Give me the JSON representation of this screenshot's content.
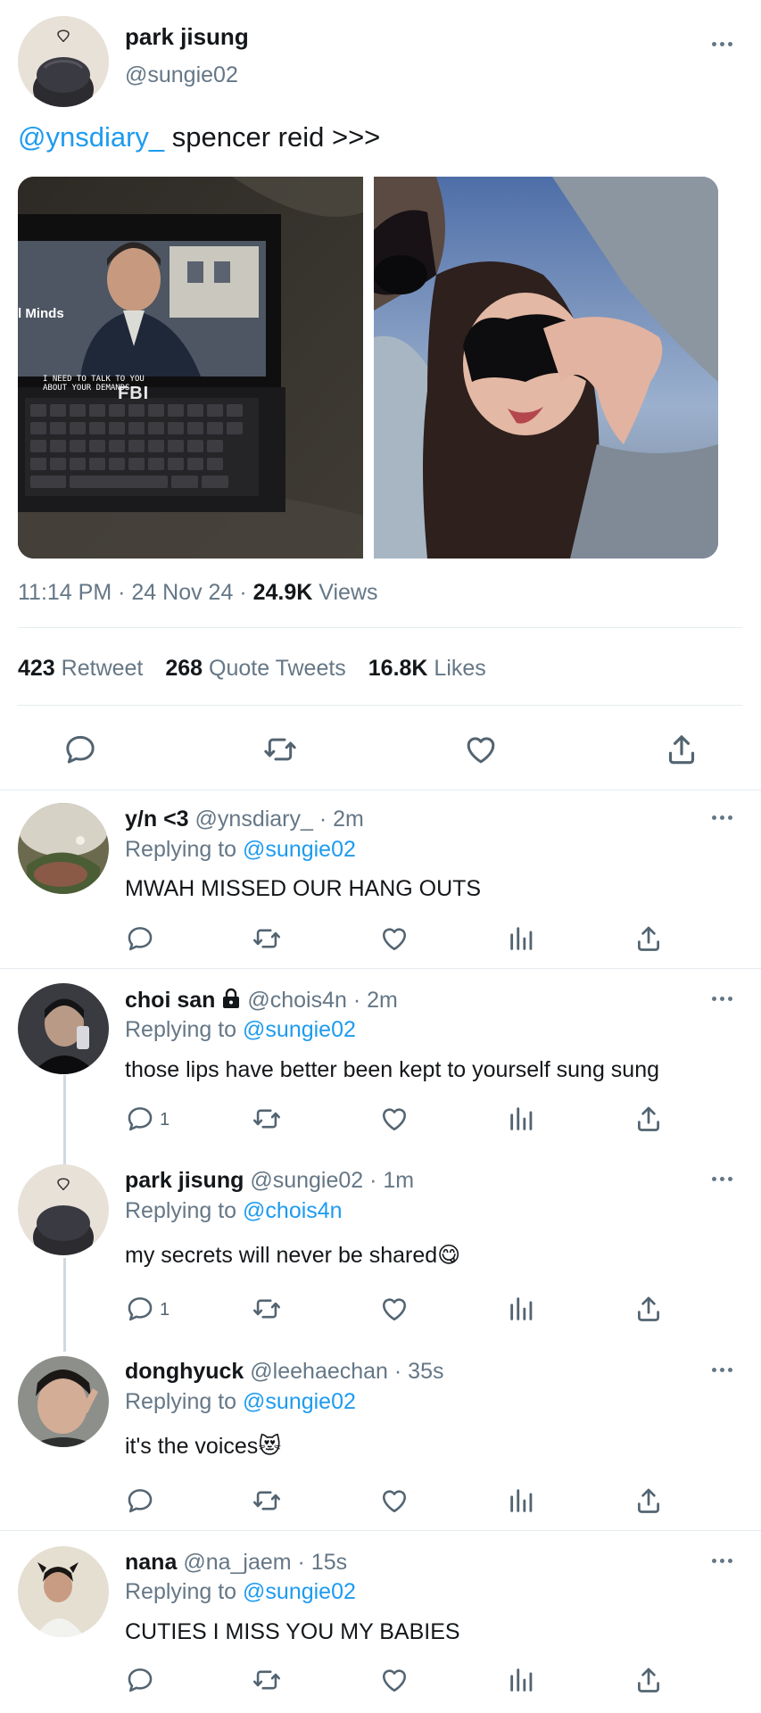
{
  "main_tweet": {
    "display_name": "park jisung",
    "handle": "@sungie02",
    "mention": "@ynsdiary_",
    "text": " spencer reid >>>",
    "image_1_overlay": {
      "show_title": "l Minds",
      "subtitle_line1": "I NEED TO TALK TO YOU",
      "subtitle_line2": "ABOUT YOUR DEMANDS",
      "badge": "FBI"
    },
    "time": "11:14 PM",
    "date": "24 Nov 24",
    "sep": "·",
    "views_count": "24.9K",
    "views_label": " Views",
    "stats": {
      "retweets": "423",
      "retweets_label": " Retweet",
      "quotes": "268",
      "quotes_label": " Quote Tweets",
      "likes": "16.8K",
      "likes_label": " Likes"
    }
  },
  "replies": [
    {
      "display_name": "y/n <3",
      "handle": "@ynsdiary_",
      "time": " · 2m",
      "replying_label": "Replying to ",
      "replying_to": "@sungie02",
      "text": "MWAH MISSED OUR HANG OUTS",
      "reply_count": ""
    },
    {
      "display_name": "choi san",
      "handle": "@chois4n",
      "time": " · 2m",
      "replying_label": "Replying to ",
      "replying_to": "@sungie02",
      "text": "those lips have better been kept to yourself sung sung",
      "reply_count": "1"
    },
    {
      "display_name": "park jisung",
      "handle": "@sungie02",
      "time": " · 1m",
      "replying_label": "Replying to ",
      "replying_to": "@chois4n",
      "text": "my secrets will never be shared",
      "emoji": "😋",
      "reply_count": "1"
    },
    {
      "display_name": "donghyuck",
      "handle": "@leehaechan",
      "time": " · 35s",
      "replying_label": "Replying to ",
      "replying_to": "@sungie02",
      "text": "it's the voices",
      "emoji": "😻",
      "reply_count": ""
    },
    {
      "display_name": "nana",
      "handle": "@na_jaem",
      "time": " · 15s",
      "replying_label": "Replying to ",
      "replying_to": "@sungie02",
      "text": "CUTIES I MISS YOU MY BABIES",
      "reply_count": ""
    }
  ],
  "icons": {
    "reply": "reply-icon",
    "retweet": "retweet-icon",
    "like": "heart-icon",
    "analytics": "analytics-icon",
    "share": "share-icon",
    "more": "more-icon",
    "lock": "lock-icon"
  },
  "colors": {
    "link": "#1d9bf0",
    "muted": "#657786",
    "divider": "#e6ecf0"
  }
}
